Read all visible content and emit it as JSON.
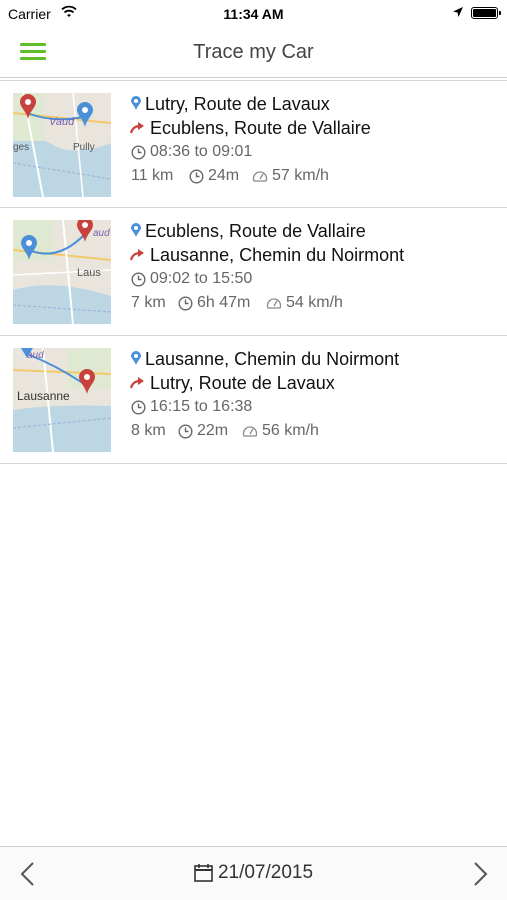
{
  "status_bar": {
    "carrier": "Carrier",
    "time": "11:34 AM",
    "battery_level": 1.0
  },
  "nav": {
    "title": "Trace my Car",
    "accent_color": "#5fbf2a"
  },
  "trips": [
    {
      "from": "Lutry, Route de Lavaux",
      "to": "Ecublens, Route de Vallaire",
      "time_range": "08:36 to 09:01",
      "distance": "11 km",
      "duration": "24m",
      "speed": "57 km/h",
      "map_labels": [
        "Vaud",
        "ges",
        "Pully"
      ]
    },
    {
      "from": "Ecublens, Route de Vallaire",
      "to": "Lausanne, Chemin du Noirmont",
      "time_range": "09:02 to 15:50",
      "distance": "7 km",
      "duration": "6h 47m",
      "speed": "54 km/h",
      "map_labels": [
        "aud",
        "Laus"
      ]
    },
    {
      "from": "Lausanne, Chemin du Noirmont",
      "to": "Lutry, Route de Lavaux",
      "time_range": "16:15 to 16:38",
      "distance": "8 km",
      "duration": "22m",
      "speed": "56 km/h",
      "map_labels": [
        "aud",
        "Lausanne"
      ]
    }
  ],
  "icons": {
    "from": "map-pin-icon",
    "to": "arrow-icon",
    "time": "clock-icon",
    "speed": "speedometer-icon",
    "date": "calendar-icon",
    "prev": "chevron-left-icon",
    "next": "chevron-right-icon"
  },
  "colors": {
    "pin_blue": "#4a90d9",
    "pin_red": "#c8413c",
    "text_secondary": "#666666"
  },
  "bottom_bar": {
    "date": "21/07/2015"
  }
}
